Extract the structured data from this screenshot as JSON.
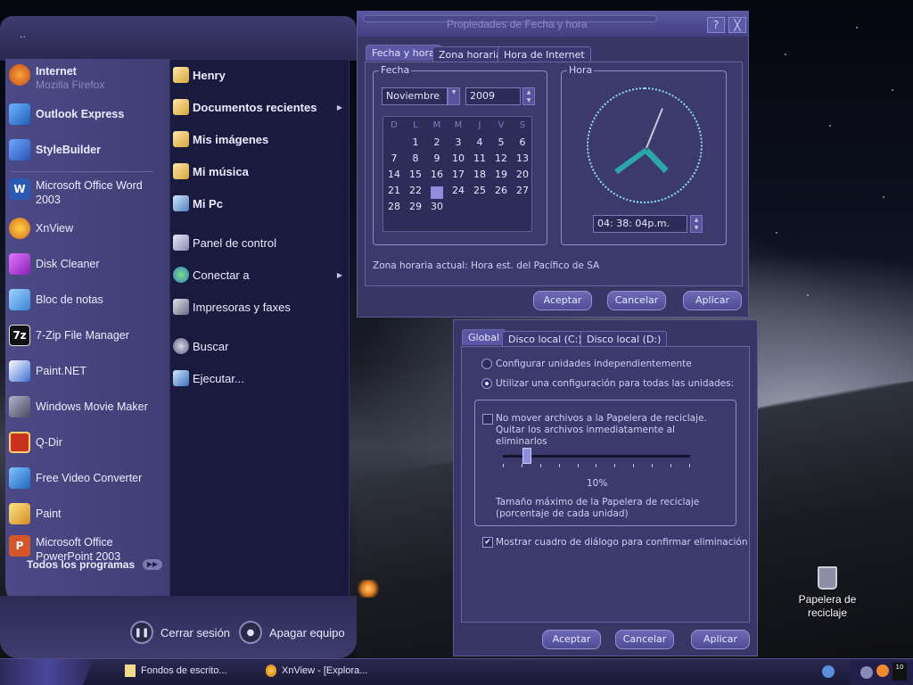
{
  "start_menu": {
    "top_dots": "..",
    "pinned": [
      {
        "label": "Internet",
        "sub": "Mozilla Firefox",
        "icon": "firefox-icon"
      },
      {
        "label": "Outlook Express",
        "icon": "outlook-icon"
      },
      {
        "label": "StyleBuilder",
        "icon": "stylebuilder-icon"
      }
    ],
    "recent": [
      {
        "label": "Microsoft Office Word 2003",
        "icon": "word-icon"
      },
      {
        "label": "XnView",
        "icon": "xnview-icon"
      },
      {
        "label": "Disk Cleaner",
        "icon": "disk-cleaner-icon"
      },
      {
        "label": "Bloc de notas",
        "icon": "notepad-icon"
      },
      {
        "label": "7-Zip File Manager",
        "icon": "7zip-icon"
      },
      {
        "label": "Paint.NET",
        "icon": "paintnet-icon"
      },
      {
        "label": "Windows Movie Maker",
        "icon": "movie-maker-icon"
      },
      {
        "label": "Q-Dir",
        "icon": "qdir-icon"
      },
      {
        "label": "Free Video Converter",
        "icon": "video-converter-icon"
      },
      {
        "label": "Paint",
        "icon": "paint-icon"
      },
      {
        "label": "Microsoft Office PowerPoint 2003",
        "icon": "powerpoint-icon"
      }
    ],
    "all_programs": "Todos los programas",
    "places": [
      {
        "label": "Henry",
        "bold": true
      },
      {
        "label": "Documentos recientes",
        "bold": true,
        "arrow": true
      },
      {
        "label": "Mis imágenes",
        "bold": true
      },
      {
        "label": "Mi música",
        "bold": true
      },
      {
        "label": "Mi Pc",
        "bold": true
      },
      {
        "label": "Panel de control"
      },
      {
        "label": "Conectar a",
        "arrow": true
      },
      {
        "label": "Impresoras y faxes"
      },
      {
        "label": "Buscar"
      },
      {
        "label": "Ejecutar..."
      }
    ],
    "logoff": "Cerrar sesión",
    "shutdown": "Apagar equipo"
  },
  "datetime_dialog": {
    "title": "Propiedades de Fecha y hora",
    "help_btn": "?",
    "close_btn": "╳",
    "tabs": [
      "Fecha y hora",
      "Zona horaria",
      "Hora de Internet"
    ],
    "date_group": "Fecha",
    "time_group": "Hora",
    "month": "Noviembre",
    "year": "2009",
    "weekdays": [
      "D",
      "L",
      "M",
      "M",
      "J",
      "V",
      "S"
    ],
    "days": [
      "",
      "1",
      "2",
      "3",
      "4",
      "5",
      "6",
      "7",
      "8",
      "9",
      "10",
      "11",
      "12",
      "13",
      "14",
      "15",
      "16",
      "17",
      "18",
      "19",
      "20",
      "21",
      "22",
      "23",
      "24",
      "25",
      "26",
      "27",
      "28",
      "29",
      "30"
    ],
    "selected_day": "23",
    "time": "04: 38: 04p.m.",
    "timezone_label": "Zona horaria actual:  Hora est. del Pacífico de SA",
    "ok": "Aceptar",
    "cancel": "Cancelar",
    "apply": "Aplicar"
  },
  "recycle_dialog": {
    "tabs": [
      "Global",
      "Disco local  (C:)",
      "Disco local (D:)"
    ],
    "radio_independent": "Configurar unidades independientemente",
    "radio_all": "Utilizar una configuración para todas las unidades:",
    "no_move_check": "No mover archivos a la Papelera de reciclaje. Quitar los archivos inmediatamente al eliminarlos",
    "percent": "10%",
    "percent_value": 0.1,
    "max_size_label": "Tamaño máximo de la Papelera de reciclaje (porcentaje de cada unidad)",
    "confirm_check": "Mostrar cuadro de diálogo para confirmar eliminación",
    "ok": "Aceptar",
    "cancel": "Cancelar",
    "apply": "Aplicar"
  },
  "desktop": {
    "recycle_bin": "Papelera de reciclaje"
  },
  "taskbar": {
    "items": [
      {
        "label": "Fondos de escrito...",
        "icon": "folder-icon"
      },
      {
        "label": "XnView - [Explora...",
        "icon": "xnview-icon"
      }
    ],
    "tray_time": "10"
  }
}
